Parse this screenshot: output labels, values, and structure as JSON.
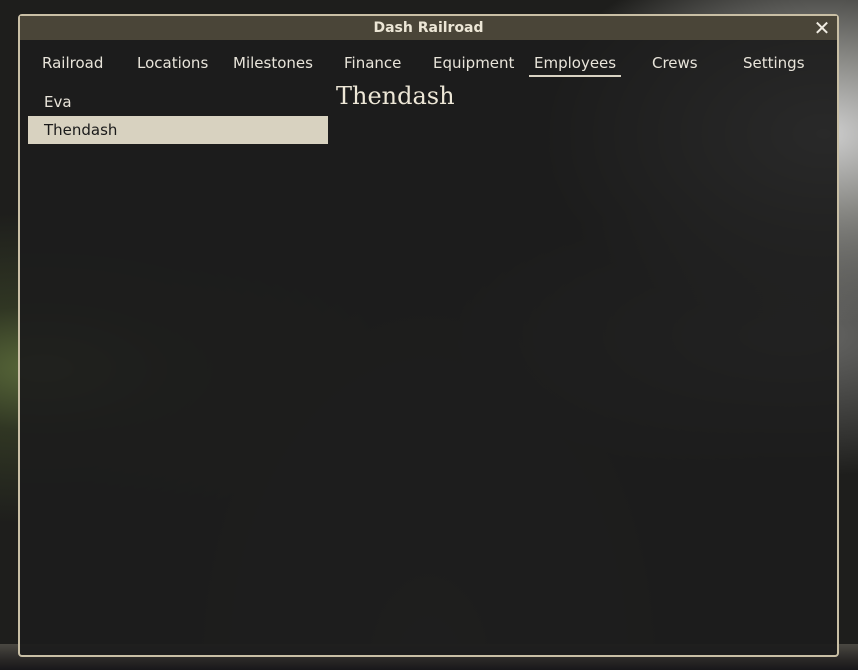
{
  "window": {
    "title": "Dash Railroad",
    "close_glyph": "✕"
  },
  "nav": {
    "tabs": [
      {
        "label": "Railroad"
      },
      {
        "label": "Locations"
      },
      {
        "label": "Milestones"
      },
      {
        "label": "Finance"
      },
      {
        "label": "Equipment"
      },
      {
        "label": "Employees"
      },
      {
        "label": "Crews"
      },
      {
        "label": "Settings"
      }
    ],
    "active": "Employees"
  },
  "employees": [
    {
      "name": "Eva",
      "selected": false
    },
    {
      "name": "Thendash",
      "selected": true
    }
  ],
  "detail": {
    "title": "Thendash"
  },
  "colors": {
    "frame": "#c9bfa5",
    "titlebar": "#4a4538",
    "selected_row": "#d8d2c0",
    "text": "#e8e4da"
  },
  "icons": {
    "close": "close-icon"
  }
}
